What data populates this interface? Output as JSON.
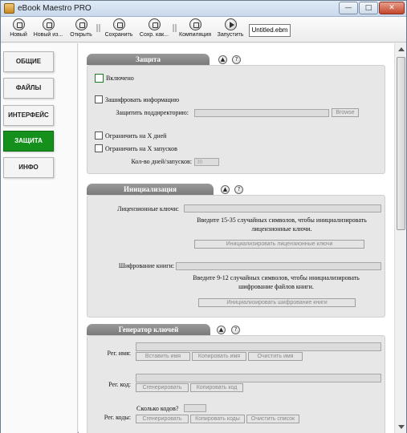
{
  "window": {
    "title": "eBook Maestro PRO",
    "min": "—",
    "max": "□",
    "close": "✕"
  },
  "toolbar": {
    "items": [
      {
        "label": "Новый",
        "icon": "new-icon"
      },
      {
        "label": "Новый из...",
        "icon": "new-from-icon"
      },
      {
        "label": "Открыть",
        "icon": "open-icon"
      },
      {
        "label": "Сохранить",
        "icon": "save-icon"
      },
      {
        "label": "Сохр. как...",
        "icon": "save-as-icon"
      },
      {
        "label": "Компиляция",
        "icon": "compile-icon"
      },
      {
        "label": "Запустить",
        "icon": "run-icon"
      }
    ],
    "filename": "Untitled.ebm"
  },
  "nav": [
    {
      "label": "ОБЩИЕ",
      "active": false
    },
    {
      "label": "ФАЙЛЫ",
      "active": false
    },
    {
      "label": "ИНТЕРФЕЙС",
      "active": false
    },
    {
      "label": "ЗАЩИТА",
      "active": true
    },
    {
      "label": "ИНФО",
      "active": false
    }
  ],
  "protection": {
    "title": "Защита",
    "enabled_label": "Включено",
    "encrypt_label": "Зашифровать информацию",
    "protect_subdir_label": "Защитить поддиректорию:",
    "browse_label": "Browse",
    "limit_days_label": "Ограничить на X дней",
    "limit_runs_label": "Ограничить на X запусков",
    "count_label": "Кол-во дней/запусков:",
    "count_value": "30"
  },
  "init": {
    "title": "Инициализация",
    "license_keys_label": "Лицензионные ключи:",
    "license_note": "Введите 15-35 случайных символов, чтобы инициализировать лицензионные ключи.",
    "license_button": "Инициализировать лицензионные ключи",
    "book_encrypt_label": "Шифрование книги:",
    "book_note": "Введите 9-12 случайных символов, чтобы инициализировать шифрование файлов книги.",
    "book_button": "Инициализировать шифрование книги"
  },
  "keygen": {
    "title": "Генератор ключей",
    "reg_name_label": "Рег. имя:",
    "insert_name": "Вставить имя",
    "copy_name": "Копировать имя",
    "clear_name": "Очистить имя",
    "reg_code_label": "Рег. код:",
    "generate": "Сгенерировать",
    "copy_code": "Копировать код",
    "how_many_label": "Сколько кодов?",
    "reg_codes_label": "Рег. коды:",
    "generate2": "Сгенерировать",
    "copy_codes": "Копировать коды",
    "clear_list": "Очистить список"
  },
  "section_controls": {
    "collapse": "▲",
    "help": "?"
  }
}
